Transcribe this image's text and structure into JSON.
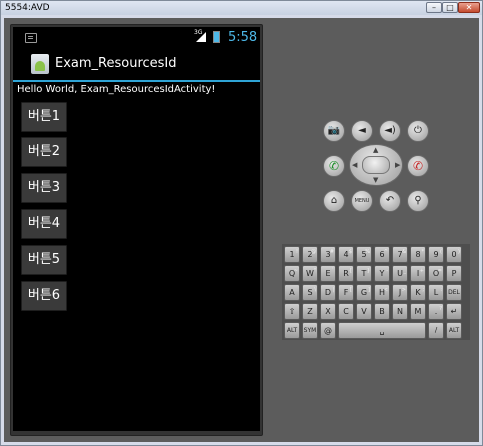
{
  "window": {
    "title": "5554:AVD",
    "min": "–",
    "max": "□",
    "close": "✕"
  },
  "status": {
    "network": "3G",
    "clock": "5:58"
  },
  "app": {
    "title": "Exam_ResourcesId",
    "hello": "Hello World, Exam_ResourcesIdActivity!"
  },
  "buttons": [
    "버튼1",
    "버튼2",
    "버튼3",
    "버튼4",
    "버튼5",
    "버튼6"
  ],
  "controls": {
    "camera": "📷",
    "vol_down": "◄",
    "vol_up": "◄)",
    "power": "⏻",
    "call": "✆",
    "end_call": "✆",
    "home": "⌂",
    "menu": "MENU",
    "back": "↶",
    "search": "⚲"
  },
  "keyboard": {
    "row1": [
      "1",
      "2",
      "3",
      "4",
      "5",
      "6",
      "7",
      "8",
      "9",
      "0"
    ],
    "row1_sub": [
      "!",
      "@",
      "#",
      "$",
      "%",
      "^",
      "&",
      "*",
      "(",
      ")"
    ],
    "row2": [
      "Q",
      "W",
      "E",
      "R",
      "T",
      "Y",
      "U",
      "I",
      "O",
      "P"
    ],
    "row2_sub": [
      "~",
      "\"",
      "`",
      "{",
      "}",
      "-",
      "_",
      "+",
      "=",
      ""
    ],
    "row3": [
      "A",
      "S",
      "D",
      "F",
      "G",
      "H",
      "J",
      "K",
      "L",
      "DEL"
    ],
    "row3_sub": [
      "",
      "\\",
      "|",
      "[",
      "]",
      "<",
      ">",
      ";",
      ":",
      ""
    ],
    "row4": [
      "⇧",
      "Z",
      "X",
      "C",
      "V",
      "B",
      "N",
      "M",
      ".",
      "↵"
    ],
    "row4_sub": [
      "",
      "",
      "",
      "",
      "",
      "",
      "",
      "",
      "?",
      "/"
    ],
    "row5": [
      "ALT",
      "SYM",
      "@",
      "␣",
      "→|",
      "?",
      "/",
      ",",
      "ALT"
    ]
  }
}
